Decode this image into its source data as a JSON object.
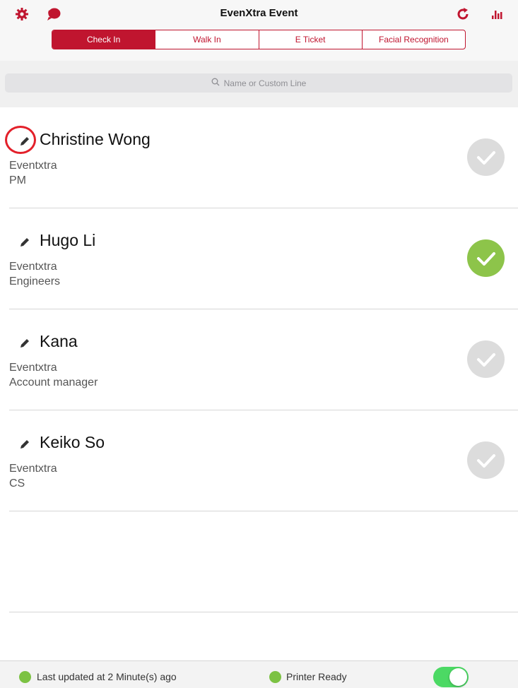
{
  "header": {
    "title": "EvenXtra Event",
    "accent": "#c0152f",
    "icons": {
      "settings": "gear-icon",
      "chat": "chat-bubble-icon",
      "refresh": "refresh-icon",
      "stats": "bar-chart-icon"
    }
  },
  "tabs": [
    {
      "label": "Check In",
      "active": true
    },
    {
      "label": "Walk In",
      "active": false
    },
    {
      "label": "E Ticket",
      "active": false
    },
    {
      "label": "Facial Recognition",
      "active": false
    }
  ],
  "search": {
    "placeholder": "Name or Custom Line"
  },
  "attendees": [
    {
      "name": "Christine Wong",
      "company": "Eventxtra",
      "position": "PM",
      "checked_in": false,
      "edit_highlighted": true
    },
    {
      "name": "Hugo Li",
      "company": "Eventxtra",
      "position": "Engineers",
      "checked_in": true,
      "edit_highlighted": false
    },
    {
      "name": "Kana",
      "company": "Eventxtra",
      "position": "Account manager",
      "checked_in": false,
      "edit_highlighted": false
    },
    {
      "name": "Keiko So",
      "company": "Eventxtra",
      "position": "CS",
      "checked_in": false,
      "edit_highlighted": false
    }
  ],
  "status": {
    "last_updated": "Last updated at 2 Minute(s) ago",
    "printer": "Printer Ready",
    "printer_toggle_on": true,
    "status_color": "#7cc243"
  }
}
